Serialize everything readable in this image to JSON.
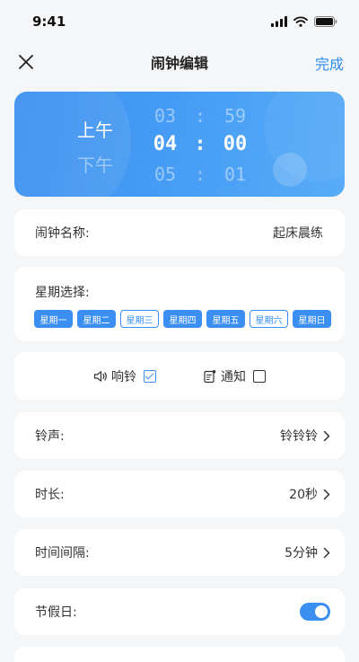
{
  "status": {
    "time": "9:41"
  },
  "nav": {
    "title": "闹钟编辑",
    "done": "完成"
  },
  "picker": {
    "ampm_active": "上午",
    "ampm_other": "下午",
    "prev": {
      "hour": "03",
      "minute": "59"
    },
    "current": {
      "hour": "04",
      "minute": "00"
    },
    "next": {
      "hour": "05",
      "minute": "01"
    },
    "separator": ":"
  },
  "name_row": {
    "label": "闹钟名称:",
    "value": "起床晨练"
  },
  "week": {
    "label": "星期选择:",
    "days": [
      {
        "label": "星期一",
        "selected": true
      },
      {
        "label": "星期二",
        "selected": true
      },
      {
        "label": "星期三",
        "selected": false
      },
      {
        "label": "星期四",
        "selected": true
      },
      {
        "label": "星期五",
        "selected": true
      },
      {
        "label": "星期六",
        "selected": false
      },
      {
        "label": "星期日",
        "selected": true
      }
    ]
  },
  "options": {
    "ring": {
      "label": "响铃",
      "checked": true
    },
    "notify": {
      "label": "通知",
      "checked": false
    }
  },
  "ringtone_row": {
    "label": "铃声:",
    "value": "铃铃铃"
  },
  "duration_row": {
    "label": "时长:",
    "value": "20秒"
  },
  "interval_row": {
    "label": "时间间隔:",
    "value": "5分钟"
  },
  "holiday_row": {
    "label": "节假日:",
    "enabled": true
  },
  "colors": {
    "accent": "#3a8ff0",
    "background": "#f5f6f8"
  }
}
